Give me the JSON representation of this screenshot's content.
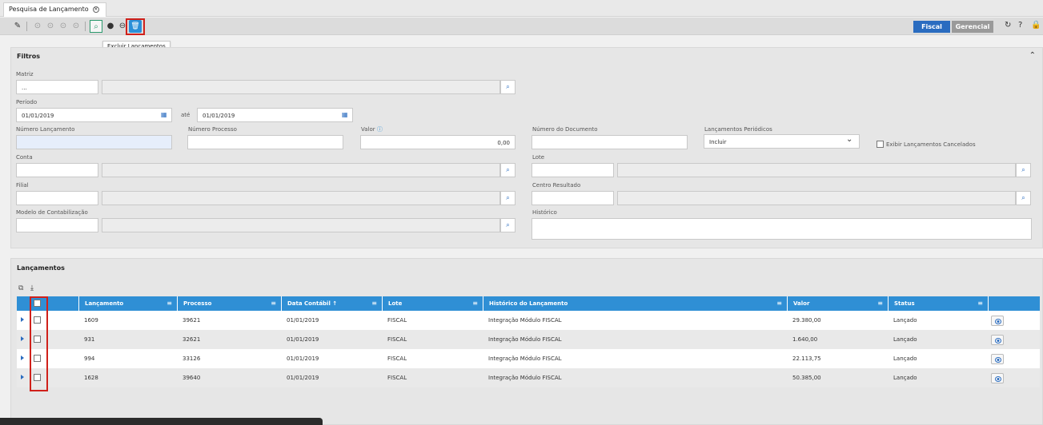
{
  "tab": {
    "title": "Pesquisa de Lançamento",
    "close_icon": "close-circle-icon"
  },
  "toolbar": {
    "icons": [
      "broom-icon",
      "first-icon",
      "prev-icon",
      "next-icon",
      "last-icon",
      "search-icon",
      "add-icon",
      "remove-icon",
      "trash-icon"
    ],
    "tooltip": "Excluir Lançamentos",
    "mode_fiscal": "Fiscal",
    "mode_gerencial": "Gerencial",
    "right_icons": [
      "refresh-icon",
      "help-icon",
      "lock-icon"
    ],
    "accent": "#2a6cc0"
  },
  "filters": {
    "title": "Filtros",
    "matriz": {
      "label": "Matriz",
      "code": "...",
      "name": ""
    },
    "periodo": {
      "label": "Período",
      "from": "01/01/2019",
      "sep": "até",
      "to": "01/01/2019"
    },
    "numero_lancamento": {
      "label": "Número Lançamento",
      "value": ""
    },
    "numero_processo": {
      "label": "Número Processo",
      "value": ""
    },
    "valor": {
      "label": "Valor",
      "value": "0,00"
    },
    "numero_documento": {
      "label": "Número do Documento",
      "value": ""
    },
    "lanc_periodicos": {
      "label": "Lançamentos Periódicos",
      "value": "Incluir"
    },
    "exibir_cancelados": {
      "label": "Exibir Lançamentos Cancelados",
      "checked": false
    },
    "conta": {
      "label": "Conta"
    },
    "lote": {
      "label": "Lote"
    },
    "filial": {
      "label": "Filial"
    },
    "centro_resultado": {
      "label": "Centro Resultado"
    },
    "modelo": {
      "label": "Modelo de Contabilização"
    },
    "historico": {
      "label": "Histórico"
    }
  },
  "grid": {
    "title": "Lançamentos",
    "header_color": "#2f8fd5",
    "columns": [
      "Lançamento",
      "Processo",
      "Data Contábil",
      "Lote",
      "Histórico do Lançamento",
      "Valor",
      "Status"
    ],
    "sort_indicator": "↑",
    "rows": [
      {
        "lancamento": "1609",
        "processo": "39621",
        "data": "01/01/2019",
        "lote": "FISCAL",
        "historico": "Integração Módulo FISCAL",
        "valor": "29.380,00",
        "status": "Lançado"
      },
      {
        "lancamento": "931",
        "processo": "32621",
        "data": "01/01/2019",
        "lote": "FISCAL",
        "historico": "Integração Módulo FISCAL",
        "valor": "1.640,00",
        "status": "Lançado"
      },
      {
        "lancamento": "994",
        "processo": "33126",
        "data": "01/01/2019",
        "lote": "FISCAL",
        "historico": "Integração Módulo FISCAL",
        "valor": "22.113,75",
        "status": "Lançado"
      },
      {
        "lancamento": "1628",
        "processo": "39640",
        "data": "01/01/2019",
        "lote": "FISCAL",
        "historico": "Integração Módulo FISCAL",
        "valor": "50.385,00",
        "status": "Lançado"
      }
    ]
  }
}
